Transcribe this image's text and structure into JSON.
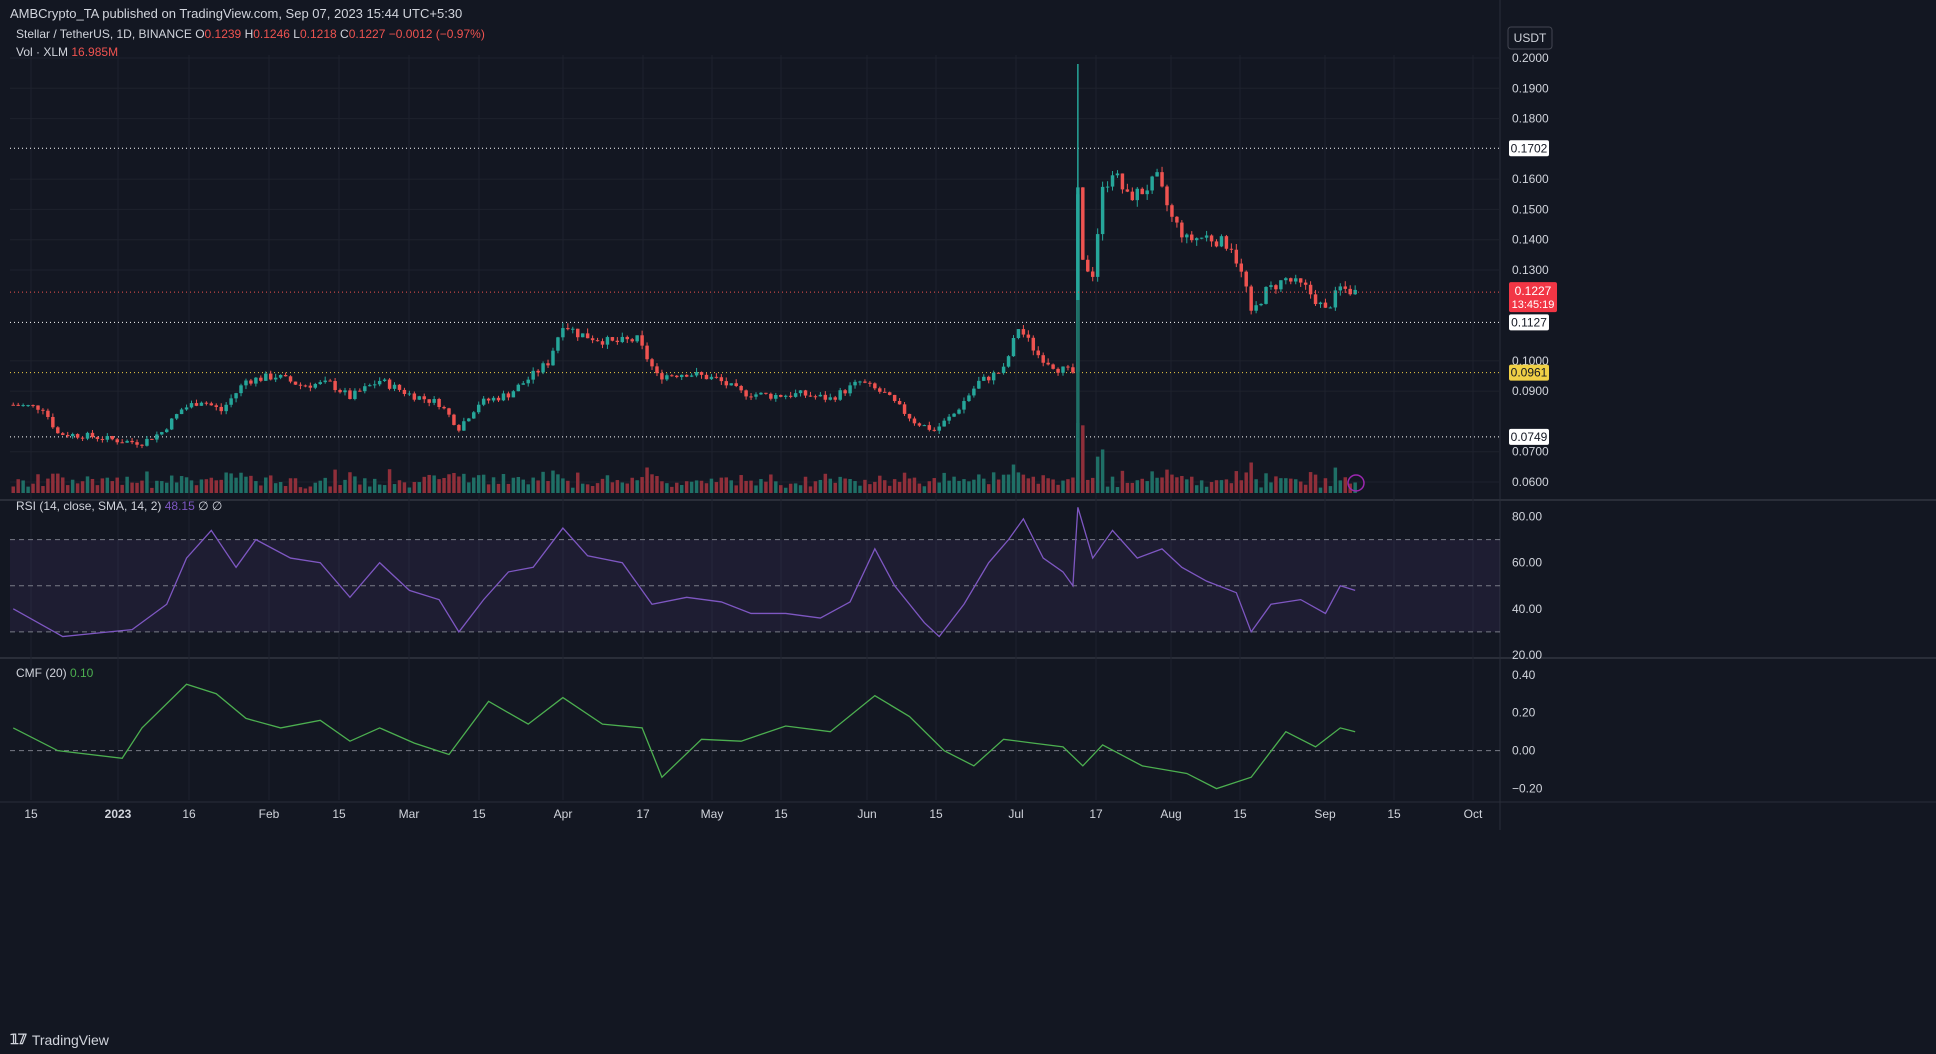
{
  "header": {
    "publisher": "AMBCrypto_TA published on TradingView.com, Sep 07, 2023 15:44 UTC+5:30",
    "symbol": "Stellar / TetherUS, 1D, BINANCE",
    "ohlc": {
      "o": "0.1239",
      "h": "0.1246",
      "l": "0.1218",
      "c": "0.1227",
      "chg": "−0.0012 (−0.97%)"
    },
    "vol_label": "Vol · XLM",
    "vol_value": "16.985M",
    "currency": "USDT"
  },
  "footer": {
    "brand": "TradingView"
  },
  "chart_data": [
    {
      "type": "candlestick",
      "title": "Stellar / TetherUS, 1D, BINANCE",
      "x_ticks": [
        "15",
        "2023",
        "16",
        "Feb",
        "15",
        "Mar",
        "15",
        "Apr",
        "17",
        "May",
        "15",
        "Jun",
        "15",
        "Jul",
        "17",
        "Aug",
        "15",
        "Sep",
        "15",
        "Oct"
      ],
      "y_ticks": [
        "0.2000",
        "0.1900",
        "0.1800",
        "0.1600",
        "0.1500",
        "0.1400",
        "0.1300",
        "0.1000",
        "0.0900",
        "0.0700",
        "0.0600"
      ],
      "ylim": [
        0.06,
        0.2
      ],
      "close_path": [
        [
          "2022-12-10",
          0.0855
        ],
        [
          "2022-12-16",
          0.0845
        ],
        [
          "2022-12-19",
          0.076
        ],
        [
          "2022-12-25",
          0.0752
        ],
        [
          "2023-01-01",
          0.0735
        ],
        [
          "2023-01-05",
          0.073
        ],
        [
          "2023-01-09",
          0.0765
        ],
        [
          "2023-01-13",
          0.084
        ],
        [
          "2023-01-17",
          0.087
        ],
        [
          "2023-01-21",
          0.0835
        ],
        [
          "2023-01-26",
          0.0935
        ],
        [
          "2023-02-01",
          0.095
        ],
        [
          "2023-02-06",
          0.092
        ],
        [
          "2023-02-12",
          0.0925
        ],
        [
          "2023-02-16",
          0.088
        ],
        [
          "2023-02-22",
          0.0935
        ],
        [
          "2023-02-28",
          0.089
        ],
        [
          "2023-03-06",
          0.086
        ],
        [
          "2023-03-10",
          0.078
        ],
        [
          "2023-03-14",
          0.086
        ],
        [
          "2023-03-20",
          0.089
        ],
        [
          "2023-03-24",
          0.094
        ],
        [
          "2023-03-28",
          0.0995
        ],
        [
          "2023-03-31",
          0.1125
        ],
        [
          "2023-04-03",
          0.109
        ],
        [
          "2023-04-10",
          0.106
        ],
        [
          "2023-04-15",
          0.107
        ],
        [
          "2023-04-19",
          0.095
        ],
        [
          "2023-04-25",
          0.096
        ],
        [
          "2023-05-01",
          0.094
        ],
        [
          "2023-05-06",
          0.0895
        ],
        [
          "2023-05-12",
          0.0885
        ],
        [
          "2023-05-18",
          0.089
        ],
        [
          "2023-05-24",
          0.0875
        ],
        [
          "2023-05-30",
          0.093
        ],
        [
          "2023-06-04",
          0.089
        ],
        [
          "2023-06-10",
          0.08
        ],
        [
          "2023-06-14",
          0.077
        ],
        [
          "2023-06-18",
          0.0825
        ],
        [
          "2023-06-23",
          0.093
        ],
        [
          "2023-06-28",
          0.097
        ],
        [
          "2023-07-01",
          0.111
        ],
        [
          "2023-07-05",
          0.102
        ],
        [
          "2023-07-09",
          0.0975
        ],
        [
          "2023-07-12",
          0.096
        ],
        [
          "2023-07-13",
          0.155
        ],
        [
          "2023-07-14",
          0.132
        ],
        [
          "2023-07-16",
          0.129
        ],
        [
          "2023-07-18",
          0.156
        ],
        [
          "2023-07-20",
          0.163
        ],
        [
          "2023-07-23",
          0.154
        ],
        [
          "2023-07-26",
          0.156
        ],
        [
          "2023-07-29",
          0.16
        ],
        [
          "2023-08-01",
          0.147
        ],
        [
          "2023-08-04",
          0.14
        ],
        [
          "2023-08-08",
          0.141
        ],
        [
          "2023-08-13",
          0.138
        ],
        [
          "2023-08-16",
          0.124
        ],
        [
          "2023-08-17",
          0.115
        ],
        [
          "2023-08-20",
          0.123
        ],
        [
          "2023-08-24",
          0.127
        ],
        [
          "2023-08-28",
          0.124
        ],
        [
          "2023-09-01",
          0.1165
        ],
        [
          "2023-09-04",
          0.124
        ],
        [
          "2023-09-07",
          0.1227
        ]
      ]
    },
    {
      "type": "horizontal_levels",
      "levels": [
        {
          "value": "0.1702",
          "style": "dotted",
          "color": "#ffffff"
        },
        {
          "value": "0.1127",
          "style": "dotted",
          "color": "#ffffff"
        },
        {
          "value": "0.0961",
          "style": "dotted",
          "color": "#f0d046"
        },
        {
          "value": "0.0749",
          "style": "dotted",
          "color": "#ffffff"
        }
      ],
      "price_tag": {
        "value": "0.1227",
        "countdown": "13:45:19",
        "color": "#f23645"
      }
    },
    {
      "type": "line",
      "title": "RSI (14, close, SMA, 14, 2)",
      "value": "48.15",
      "suffix": "∅ ∅",
      "y_ticks": [
        "80.00",
        "60.00",
        "40.00",
        "20.00"
      ],
      "ylim": [
        20,
        85
      ],
      "band": [
        30,
        70
      ],
      "mid": 50,
      "color": "#7e57c2",
      "series": [
        [
          "2022-12-10",
          40
        ],
        [
          "2022-12-20",
          28
        ],
        [
          "2023-01-03",
          31
        ],
        [
          "2023-01-10",
          42
        ],
        [
          "2023-01-14",
          62
        ],
        [
          "2023-01-19",
          74
        ],
        [
          "2023-01-24",
          58
        ],
        [
          "2023-01-28",
          70
        ],
        [
          "2023-02-04",
          62
        ],
        [
          "2023-02-10",
          60
        ],
        [
          "2023-02-16",
          45
        ],
        [
          "2023-02-22",
          60
        ],
        [
          "2023-02-28",
          48
        ],
        [
          "2023-03-06",
          44
        ],
        [
          "2023-03-10",
          30
        ],
        [
          "2023-03-15",
          44
        ],
        [
          "2023-03-20",
          56
        ],
        [
          "2023-03-25",
          58
        ],
        [
          "2023-03-31",
          75
        ],
        [
          "2023-04-05",
          63
        ],
        [
          "2023-04-12",
          60
        ],
        [
          "2023-04-18",
          42
        ],
        [
          "2023-04-25",
          45
        ],
        [
          "2023-05-02",
          43
        ],
        [
          "2023-05-08",
          38
        ],
        [
          "2023-05-15",
          38
        ],
        [
          "2023-05-22",
          36
        ],
        [
          "2023-05-28",
          43
        ],
        [
          "2023-06-02",
          66
        ],
        [
          "2023-06-06",
          50
        ],
        [
          "2023-06-12",
          34
        ],
        [
          "2023-06-15",
          28
        ],
        [
          "2023-06-20",
          42
        ],
        [
          "2023-06-25",
          60
        ],
        [
          "2023-06-29",
          70
        ],
        [
          "2023-07-02",
          79
        ],
        [
          "2023-07-06",
          62
        ],
        [
          "2023-07-10",
          56
        ],
        [
          "2023-07-12",
          50
        ],
        [
          "2023-07-13",
          84
        ],
        [
          "2023-07-16",
          62
        ],
        [
          "2023-07-20",
          74
        ],
        [
          "2023-07-25",
          62
        ],
        [
          "2023-07-30",
          66
        ],
        [
          "2023-08-03",
          58
        ],
        [
          "2023-08-08",
          52
        ],
        [
          "2023-08-14",
          47
        ],
        [
          "2023-08-17",
          30
        ],
        [
          "2023-08-21",
          42
        ],
        [
          "2023-08-27",
          44
        ],
        [
          "2023-09-01",
          38
        ],
        [
          "2023-09-04",
          50
        ],
        [
          "2023-09-07",
          48
        ]
      ]
    },
    {
      "type": "line",
      "title": "CMF (20)",
      "value": "0.10",
      "y_ticks": [
        "0.40",
        "0.20",
        "0.00",
        "−0.20"
      ],
      "ylim": [
        -0.26,
        0.42
      ],
      "zero": 0,
      "color": "#4caf50",
      "series": [
        [
          "2022-12-10",
          0.12
        ],
        [
          "2022-12-19",
          0.0
        ],
        [
          "2023-01-01",
          -0.04
        ],
        [
          "2023-01-05",
          0.12
        ],
        [
          "2023-01-14",
          0.35
        ],
        [
          "2023-01-20",
          0.3
        ],
        [
          "2023-01-26",
          0.17
        ],
        [
          "2023-02-02",
          0.12
        ],
        [
          "2023-02-10",
          0.16
        ],
        [
          "2023-02-16",
          0.05
        ],
        [
          "2023-02-22",
          0.12
        ],
        [
          "2023-03-01",
          0.04
        ],
        [
          "2023-03-08",
          -0.02
        ],
        [
          "2023-03-16",
          0.26
        ],
        [
          "2023-03-24",
          0.14
        ],
        [
          "2023-03-31",
          0.28
        ],
        [
          "2023-04-08",
          0.14
        ],
        [
          "2023-04-16",
          0.12
        ],
        [
          "2023-04-20",
          -0.14
        ],
        [
          "2023-04-28",
          0.06
        ],
        [
          "2023-05-06",
          0.05
        ],
        [
          "2023-05-15",
          0.13
        ],
        [
          "2023-05-24",
          0.1
        ],
        [
          "2023-06-02",
          0.29
        ],
        [
          "2023-06-09",
          0.18
        ],
        [
          "2023-06-16",
          0.0
        ],
        [
          "2023-06-22",
          -0.08
        ],
        [
          "2023-06-28",
          0.06
        ],
        [
          "2023-07-04",
          0.04
        ],
        [
          "2023-07-10",
          0.02
        ],
        [
          "2023-07-14",
          -0.08
        ],
        [
          "2023-07-18",
          0.03
        ],
        [
          "2023-07-26",
          -0.08
        ],
        [
          "2023-08-04",
          -0.12
        ],
        [
          "2023-08-10",
          -0.2
        ],
        [
          "2023-08-17",
          -0.14
        ],
        [
          "2023-08-24",
          0.1
        ],
        [
          "2023-08-30",
          0.02
        ],
        [
          "2023-09-04",
          0.12
        ],
        [
          "2023-09-07",
          0.1
        ]
      ]
    }
  ]
}
